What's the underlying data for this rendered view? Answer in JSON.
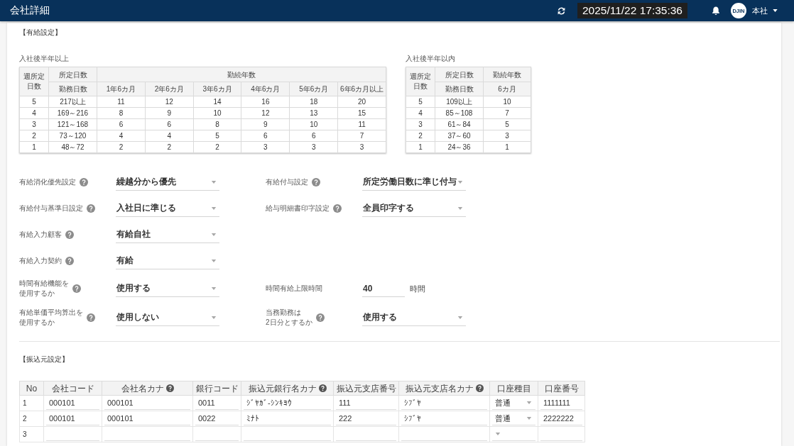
{
  "header": {
    "title": "会社詳細",
    "datetime": "2025/11/22 17:35:36",
    "avatar": "DJIN",
    "office": "本社"
  },
  "paid_leave": {
    "heading": "【有給設定】",
    "tables": [
      {
        "caption": "入社後半年以上",
        "corner": "週所定日数",
        "days_headers": [
          "所定日数",
          "勤務日数"
        ],
        "years_header": "勤続年数",
        "year_columns": [
          "1年6カ月",
          "2年6カ月",
          "3年6カ月",
          "4年6カ月",
          "5年6カ月",
          "6年6カ月以上"
        ],
        "rows": [
          [
            "5",
            "217以上",
            "11",
            "12",
            "14",
            "16",
            "18",
            "20"
          ],
          [
            "4",
            "169～216",
            "8",
            "9",
            "10",
            "12",
            "13",
            "15"
          ],
          [
            "3",
            "121～168",
            "6",
            "6",
            "8",
            "9",
            "10",
            "11"
          ],
          [
            "2",
            "73～120",
            "4",
            "4",
            "5",
            "6",
            "6",
            "7"
          ],
          [
            "1",
            "48～72",
            "2",
            "2",
            "2",
            "3",
            "3",
            "3"
          ]
        ]
      },
      {
        "caption": "入社後半年以内",
        "corner": "週所定日数",
        "days_headers": [
          "所定日数",
          "勤務日数"
        ],
        "years_header": "勤続年数",
        "year_columns": [
          "6カ月"
        ],
        "rows": [
          [
            "5",
            "109以上",
            "10"
          ],
          [
            "4",
            "85～108",
            "7"
          ],
          [
            "3",
            "61～84",
            "5"
          ],
          [
            "2",
            "37～60",
            "3"
          ],
          [
            "1",
            "24～36",
            "1"
          ]
        ]
      }
    ],
    "form_rows": [
      {
        "left": {
          "label": [
            "有給消化優先設定"
          ],
          "help": true,
          "kind": "select",
          "value": "繰越分から優先"
        },
        "right": {
          "label": [
            "有給付与設定"
          ],
          "help": true,
          "kind": "select",
          "value": "所定労働日数に準じ付与"
        }
      },
      {
        "left": {
          "label": [
            "有給付与基準日設定"
          ],
          "help": true,
          "kind": "select",
          "value": "入社日に準じる"
        },
        "right": {
          "label": [
            "給与明細書印字設定"
          ],
          "help": true,
          "kind": "select",
          "value": "全員印字する"
        }
      },
      {
        "left": {
          "label": [
            "有給入力顧客"
          ],
          "help": true,
          "kind": "select",
          "value": "有給自社"
        }
      },
      {
        "left": {
          "label": [
            "有給入力契約"
          ],
          "help": true,
          "kind": "select",
          "value": "有給"
        }
      },
      {
        "left": {
          "label": [
            "時間有給機能を",
            "使用するか"
          ],
          "help": true,
          "kind": "select",
          "value": "使用する"
        },
        "right": {
          "label": [
            "時間有給上限時間"
          ],
          "help": false,
          "kind": "number",
          "value": "40",
          "unit": "時間"
        }
      },
      {
        "left": {
          "label": [
            "有給単価平均算出を",
            "使用するか"
          ],
          "help": true,
          "kind": "select",
          "value": "使用しない"
        },
        "right": {
          "label": [
            "当務勤務は",
            "2日分とするか"
          ],
          "help": true,
          "kind": "select",
          "value": "使用する"
        }
      }
    ]
  },
  "transfer_source": {
    "heading": "【振込元設定】",
    "columns": [
      {
        "label": "No",
        "help": false,
        "kind": "index"
      },
      {
        "label": "会社コード",
        "help": false,
        "kind": "text"
      },
      {
        "label": "会社名カナ",
        "help": true,
        "kind": "text"
      },
      {
        "label": "銀行コード",
        "help": false,
        "kind": "text"
      },
      {
        "label": "振込元銀行名カナ",
        "help": true,
        "kind": "text"
      },
      {
        "label": "振込元支店番号",
        "help": false,
        "kind": "text"
      },
      {
        "label": "振込元支店名カナ",
        "help": true,
        "kind": "text"
      },
      {
        "label": "口座種目",
        "help": false,
        "kind": "select"
      },
      {
        "label": "口座番号",
        "help": false,
        "kind": "text"
      }
    ],
    "rows": [
      {
        "values": [
          "1",
          "000101",
          "000101",
          "0011",
          "ｼﾞﾔｶﾞ-ｼﾝｷﾖｳ",
          "111",
          "ｼﾌﾞﾔ",
          "普通",
          "1111111"
        ]
      },
      {
        "values": [
          "2",
          "000101",
          "000101",
          "0022",
          "ﾐﾅﾄ",
          "222",
          "ｼﾌﾞﾔ",
          "普通",
          "2222222"
        ]
      },
      {
        "values": [
          "3"
        ]
      }
    ]
  }
}
